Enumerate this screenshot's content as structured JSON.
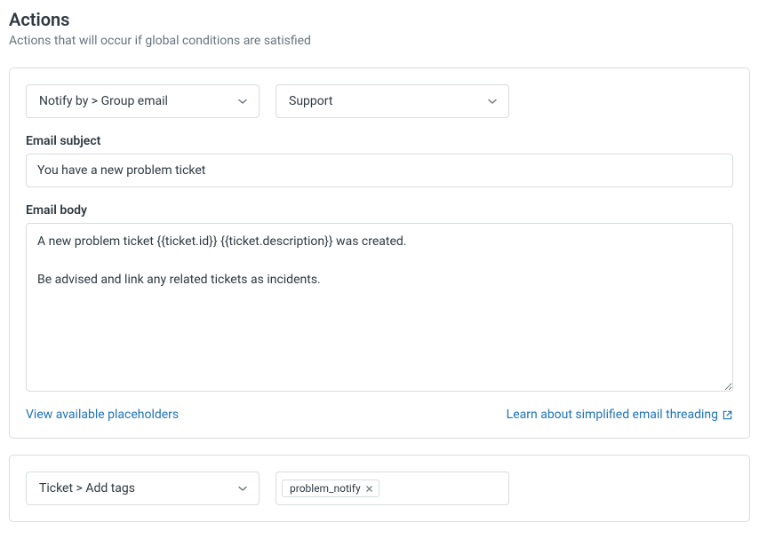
{
  "header": {
    "title": "Actions",
    "subtitle": "Actions that will occur if global conditions are satisfied"
  },
  "action1": {
    "type_select": "Notify by > Group email",
    "group_select": "Support",
    "subject_label": "Email subject",
    "subject_value": "You have a new problem ticket",
    "body_label": "Email body",
    "body_value": "A new problem ticket {{ticket.id}} {{ticket.description}} was created.\n\nBe advised and link any related tickets as incidents.",
    "placeholders_link": "View available placeholders",
    "threading_link": "Learn about simplified email threading"
  },
  "action2": {
    "type_select": "Ticket > Add tags",
    "tag_value": "problem_notify"
  }
}
